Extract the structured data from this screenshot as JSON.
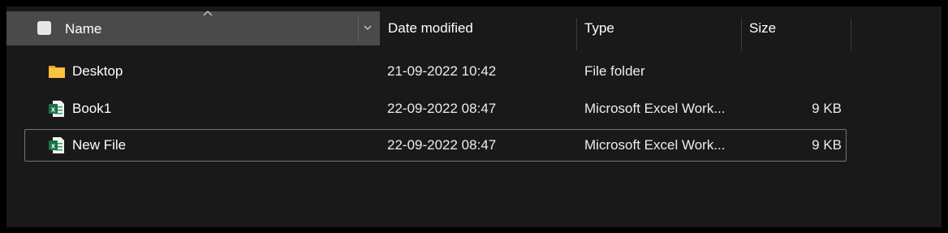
{
  "columns": {
    "name": "Name",
    "date_modified": "Date modified",
    "type": "Type",
    "size": "Size"
  },
  "files": [
    {
      "name": "Desktop",
      "date": "21-09-2022 10:42",
      "type": "File folder",
      "size": "",
      "icon": "folder-icon"
    },
    {
      "name": "Book1",
      "date": "22-09-2022 08:47",
      "type": "Microsoft Excel Work...",
      "size": "9 KB",
      "icon": "excel-file-icon"
    },
    {
      "name": "New File",
      "date": "22-09-2022 08:47",
      "type": "Microsoft Excel Work...",
      "size": "9 KB",
      "icon": "excel-file-icon",
      "selected": true
    }
  ],
  "colors": {
    "background": "#191919",
    "header_active": "#4a4a4a",
    "folder": "#f8c440",
    "excel_green": "#1e7145"
  }
}
